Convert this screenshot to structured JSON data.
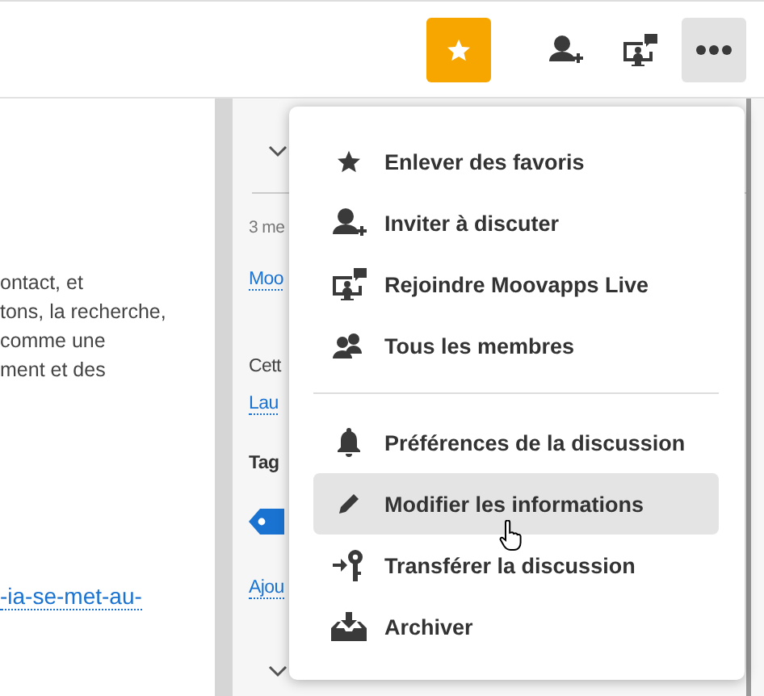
{
  "toolbar": {
    "buttons": [
      {
        "kind": "favorite",
        "on": true
      },
      {
        "kind": "invite"
      },
      {
        "kind": "live"
      },
      {
        "kind": "more",
        "on": true
      }
    ]
  },
  "content": {
    "paragraph_lines": [
      "ontact, et",
      "tons, la recherche,",
      "comme une",
      "ment et des"
    ],
    "link": "-ia-se-met-au-"
  },
  "side_panel": {
    "date": "3 me",
    "link_1": "Moo",
    "text": "Cett",
    "link_2": "Lau",
    "tags_heading": "Tag",
    "add_link": "Ajou"
  },
  "menu": {
    "groups": [
      [
        {
          "kind": "star",
          "label": "Enlever des favoris",
          "selected": false
        },
        {
          "kind": "invite",
          "label": "Inviter à discuter",
          "selected": false
        },
        {
          "kind": "live",
          "label": "Rejoindre Moovapps Live",
          "selected": false
        },
        {
          "kind": "members",
          "label": "Tous les membres",
          "selected": false
        }
      ],
      [
        {
          "kind": "bell",
          "label": "Préférences de la discussion",
          "selected": false
        },
        {
          "kind": "pencil",
          "label": "Modifier les informations",
          "selected": true
        },
        {
          "kind": "transfer",
          "label": "Transférer la discussion",
          "selected": false
        },
        {
          "kind": "archive",
          "label": "Archiver",
          "selected": false
        }
      ]
    ]
  }
}
